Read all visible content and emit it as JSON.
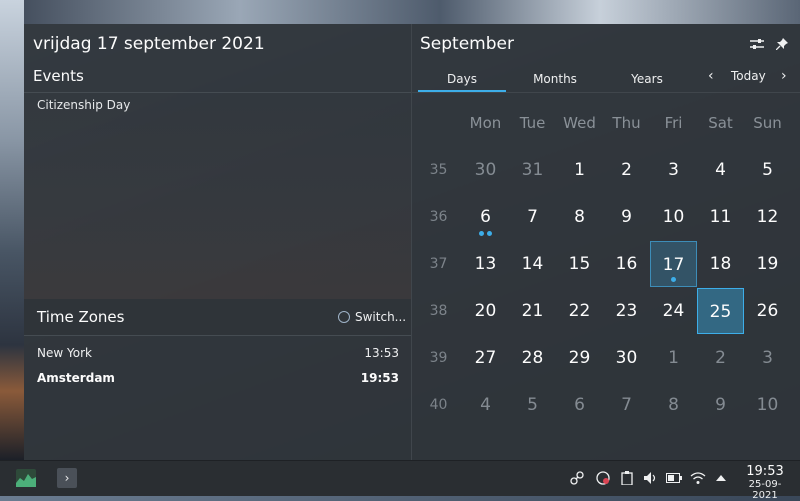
{
  "left": {
    "date_title": "vrijdag 17 september 2021",
    "events_heading": "Events",
    "events": [
      "Citizenship Day"
    ],
    "timezones": {
      "heading": "Time Zones",
      "switch_label": "Switch...",
      "rows": [
        {
          "city": "New York",
          "time": "13:53"
        },
        {
          "city": "Amsterdam",
          "time": "19:53"
        }
      ]
    }
  },
  "calendar": {
    "month_title": "September",
    "tabs": [
      "Days",
      "Months",
      "Years"
    ],
    "today_label": "Today",
    "weekdays": [
      "Mon",
      "Tue",
      "Wed",
      "Thu",
      "Fri",
      "Sat",
      "Sun"
    ],
    "weeks": [
      {
        "wk": "35",
        "days": [
          "30",
          "31",
          "1",
          "2",
          "3",
          "4",
          "5"
        ]
      },
      {
        "wk": "36",
        "days": [
          "6",
          "7",
          "8",
          "9",
          "10",
          "11",
          "12"
        ]
      },
      {
        "wk": "37",
        "days": [
          "13",
          "14",
          "15",
          "16",
          "17",
          "18",
          "19"
        ]
      },
      {
        "wk": "38",
        "days": [
          "20",
          "21",
          "22",
          "23",
          "24",
          "25",
          "26"
        ]
      },
      {
        "wk": "39",
        "days": [
          "27",
          "28",
          "29",
          "30",
          "1",
          "2",
          "3"
        ]
      },
      {
        "wk": "40",
        "days": [
          "4",
          "5",
          "6",
          "7",
          "8",
          "9",
          "10"
        ]
      }
    ],
    "selected_day": "17",
    "today_day": "25"
  },
  "panel": {
    "time": "19:53",
    "date": "25-09-2021"
  },
  "colors": {
    "accent": "#3daee9",
    "background": "#31363b"
  }
}
